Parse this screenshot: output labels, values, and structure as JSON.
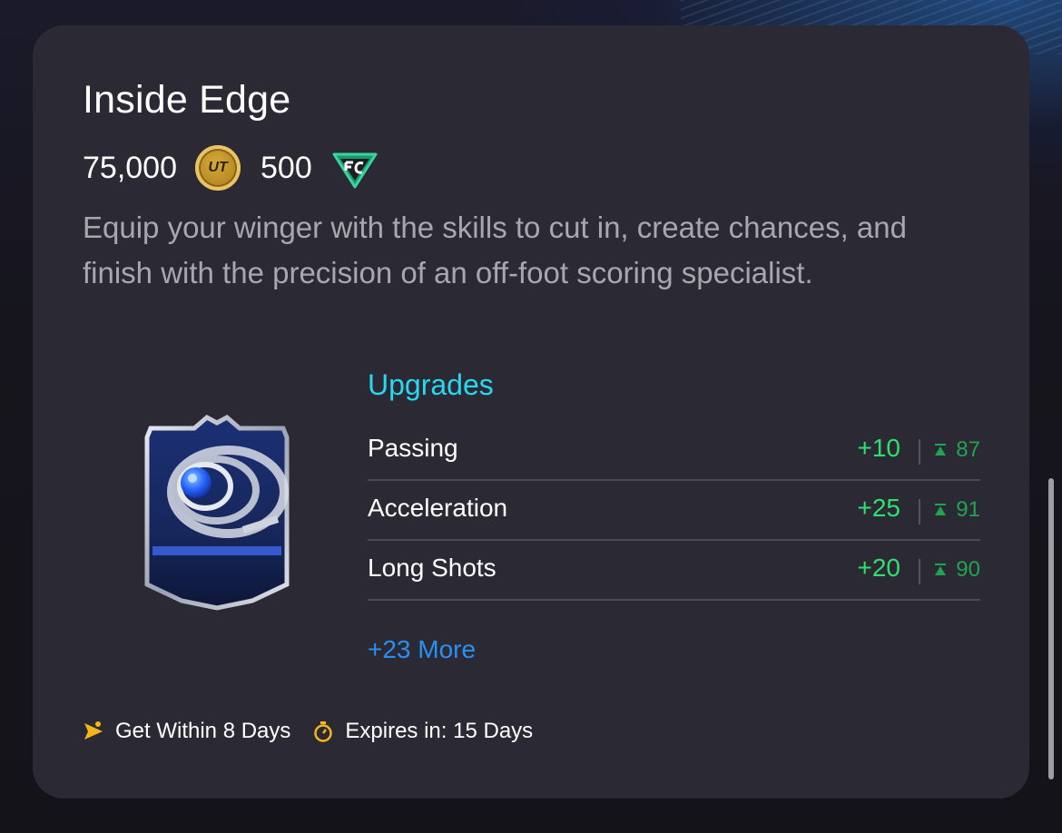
{
  "offer": {
    "title": "Inside Edge",
    "price_coins": "75,000",
    "coin_icon_text": "UT",
    "price_points": "500",
    "description": "Equip your winger with the skills to cut in, create chances, and finish with the precision of an off-foot scoring specialist."
  },
  "upgrades": {
    "heading": "Upgrades",
    "items": [
      {
        "label": "Passing",
        "boost": "+10",
        "cap": "87"
      },
      {
        "label": "Acceleration",
        "boost": "+25",
        "cap": "91"
      },
      {
        "label": "Long Shots",
        "boost": "+20",
        "cap": "90"
      }
    ],
    "more": "+23 More"
  },
  "footer": {
    "get_within": "Get Within 8 Days",
    "expires": "Expires in: 15 Days"
  },
  "colors": {
    "card_bg": "#2b2a34",
    "accent_cyan": "#27d8ee",
    "boost_green": "#2ee06c",
    "link_blue": "#2a8ff2",
    "footer_icon_yellow": "#f3b61b"
  },
  "icons": {
    "coin": "coin-icon",
    "points": "fc-points-icon",
    "cap": "cap-arrow-icon",
    "get_within": "flag-icon",
    "expires": "stopwatch-icon"
  }
}
